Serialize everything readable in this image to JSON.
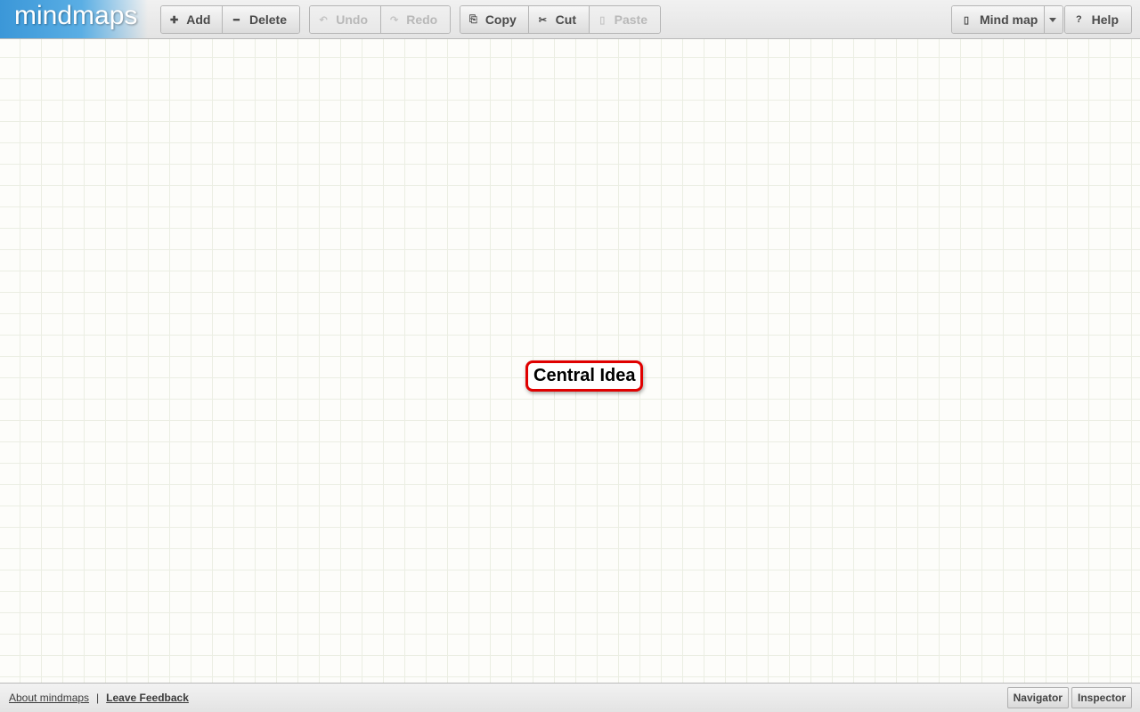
{
  "app": {
    "logo": "mindmaps"
  },
  "toolbar": {
    "add": {
      "label": "Add",
      "icon": "plus-icon",
      "glyph": "✚"
    },
    "delete": {
      "label": "Delete",
      "icon": "minus-icon",
      "glyph": "━"
    },
    "undo": {
      "label": "Undo",
      "icon": "undo-icon",
      "glyph": "↶"
    },
    "redo": {
      "label": "Redo",
      "icon": "redo-icon",
      "glyph": "↷"
    },
    "copy": {
      "label": "Copy",
      "icon": "copy-icon",
      "glyph": "⎘"
    },
    "cut": {
      "label": "Cut",
      "icon": "scissors-icon",
      "glyph": "✂"
    },
    "paste": {
      "label": "Paste",
      "icon": "clipboard-icon",
      "glyph": "▯"
    },
    "mindmap": {
      "label": "Mind map",
      "icon": "document-icon",
      "glyph": "▯"
    },
    "help": {
      "label": "Help",
      "icon": "question-icon",
      "glyph": "?"
    }
  },
  "canvas": {
    "central_node": {
      "label": "Central Idea",
      "border_color": "#e00000"
    }
  },
  "footer": {
    "about_link": "About mindmaps",
    "separator": "|",
    "feedback_link": "Leave Feedback",
    "navigator_button": "Navigator",
    "inspector_button": "Inspector"
  },
  "colors": {
    "logo_blue": "#3b97d8",
    "node_border": "#e00000",
    "grid_line": "#ebeee3"
  }
}
